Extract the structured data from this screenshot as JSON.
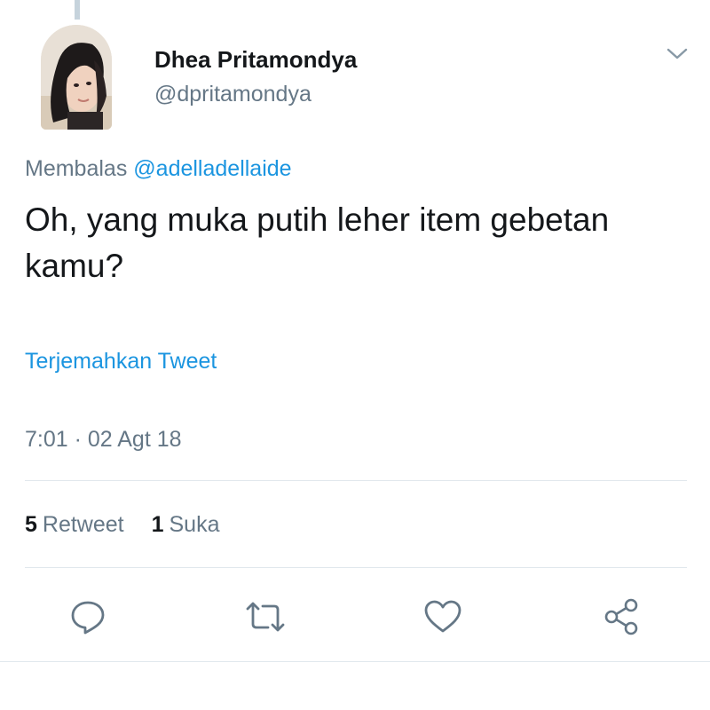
{
  "tweet": {
    "author": {
      "display_name": "Dhea Pritamondya",
      "handle": "@dpritamondya"
    },
    "reply_prefix": "Membalas",
    "reply_to": "@adelladellaide",
    "text": "Oh, yang muka putih leher item gebetan kamu?",
    "translate_label": "Terjemahkan Tweet",
    "timestamp": "7:01 · 02 Agt 18",
    "stats": {
      "retweet_count": "5",
      "retweet_label": "Retweet",
      "like_count": "1",
      "like_label": "Suka"
    }
  },
  "icons": {
    "menu": "chevron-down-icon",
    "reply": "reply-icon",
    "retweet": "retweet-icon",
    "like": "heart-icon",
    "share": "share-icon"
  },
  "colors": {
    "link": "#1b95e0",
    "text": "#14171a",
    "secondary": "#657786",
    "divider": "#e1e8ed"
  }
}
